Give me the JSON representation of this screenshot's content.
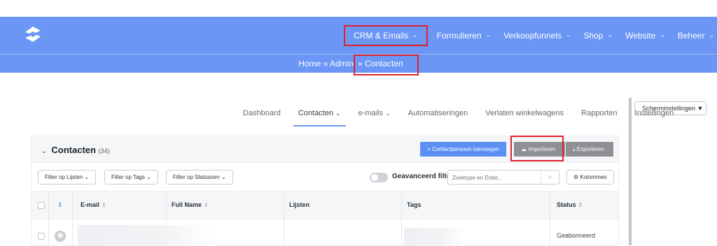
{
  "nav": {
    "logo": "logo-icon",
    "items": [
      {
        "label": "CRM & Emails",
        "active": true
      },
      {
        "label": "Formulieren"
      },
      {
        "label": "Verkoopfunnels"
      },
      {
        "label": "Shop"
      },
      {
        "label": "Website"
      },
      {
        "label": "Beheer"
      }
    ],
    "chevron": "⌄"
  },
  "breadcrumb": {
    "home": "Home",
    "sep": "»",
    "admin": "Admin",
    "current": "Contacten"
  },
  "screen_options": "Scherminstellingen ▼",
  "tabs": [
    {
      "label": "Dashboard"
    },
    {
      "label": "Contacten",
      "active": true,
      "chevron": "⌄"
    },
    {
      "label": "e-mails",
      "chevron": "⌄"
    },
    {
      "label": "Automatiseringen"
    },
    {
      "label": "Verlaten winkelwagens"
    },
    {
      "label": "Rapporten"
    },
    {
      "label": "Instellingen"
    }
  ],
  "panel": {
    "title": "Contacten",
    "count": "(34)",
    "add_label": "+ Contactpersoon toevoegen",
    "import_label": "☁ Importeren",
    "export_label": "⤓ Exporteren"
  },
  "filters": {
    "lists": "Filter op Lijsten ⌄",
    "tags": "Filter op Tags ⌄",
    "statuses": "Filter op Statussen ⌄",
    "advanced": "Geavanceerd filter",
    "search_placeholder": "Zoektype en Enter...",
    "columns": "⚙ Kolommen"
  },
  "table": {
    "headers": {
      "email": "E-mail",
      "full_name": "Full Name",
      "lists": "Lijsten",
      "tags": "Tags",
      "status": "Status"
    },
    "rows": [
      {
        "status": "Geabonneerd"
      }
    ]
  },
  "colors": {
    "brand": "#6b96f5",
    "highlight": "#e0202c",
    "primary_button": "#5b8ff4",
    "secondary_button": "#8e9095"
  }
}
